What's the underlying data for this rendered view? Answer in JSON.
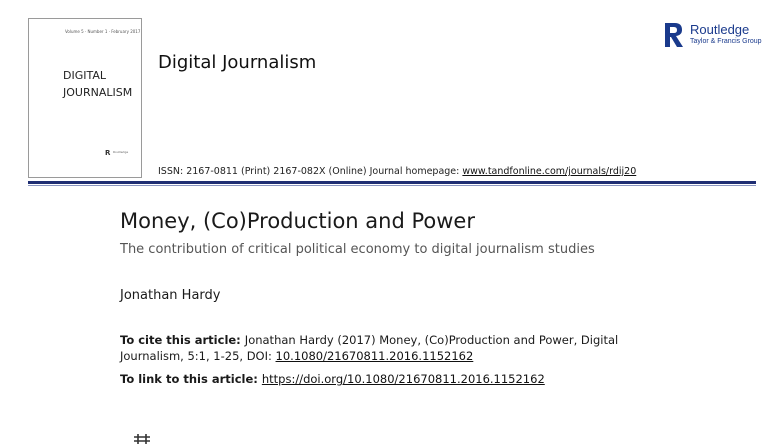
{
  "cover": {
    "volume_line": "Volume 5 · Number 1 · February 2017",
    "title_line1": "DIGITAL",
    "title_line2": "JOURNALISM",
    "logo_mark": "R",
    "logo_text": "Routledge"
  },
  "journal_name": "Digital Journalism",
  "publisher": {
    "name": "Routledge",
    "subtitle": "Taylor & Francis Group",
    "brand_color": "#1a3a8c"
  },
  "issn": {
    "text": "ISSN: 2167-0811 (Print) 2167-082X (Online) Journal homepage: ",
    "homepage_url": "www.tandfonline.com/journals/rdij20"
  },
  "rule_color": "#1f2e73",
  "article": {
    "title": "Money, (Co)Production and Power",
    "subtitle": "The contribution of critical political economy to digital journalism studies",
    "author": "Jonathan Hardy"
  },
  "citation": {
    "label": "To cite this article: ",
    "text": "Jonathan Hardy (2017) Money, (Co)Production and Power, Digital Journalism, 5:1, 1-25, DOI: ",
    "doi": "10.1080/21670811.2016.1152162"
  },
  "link_to": {
    "label": "To link to this article: ",
    "url": "https://doi.org/10.1080/21670811.2016.1152162"
  },
  "icons": {
    "bottom": "crossmark-icon"
  }
}
